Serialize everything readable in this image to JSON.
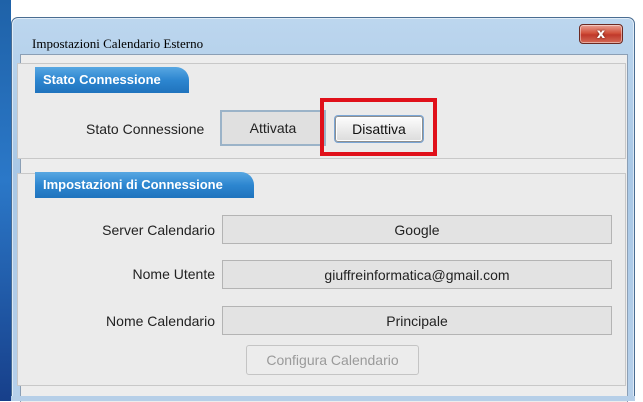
{
  "window": {
    "title": "Impostazioni Calendario Esterno",
    "close_icon": "close-icon",
    "close_glyph": "x"
  },
  "connection_status": {
    "tab_label": "Stato Connessione",
    "label": "Stato Connessione",
    "value": "Attivata",
    "deactivate_button": "Disattiva",
    "highlight_color": "#e0101a"
  },
  "connection_settings": {
    "tab_label": "Impostazioni di Connessione",
    "fields": [
      {
        "label": "Server Calendario",
        "value": "Google"
      },
      {
        "label": "Nome Utente",
        "value": "giuffreinformatica@gmail.com"
      },
      {
        "label": "Nome Calendario",
        "value": "Principale"
      }
    ],
    "configure_button": "Configura Calendario",
    "configure_enabled": false
  },
  "colors": {
    "tab_blue": "#2d86d0",
    "close_red": "#c0392b"
  }
}
